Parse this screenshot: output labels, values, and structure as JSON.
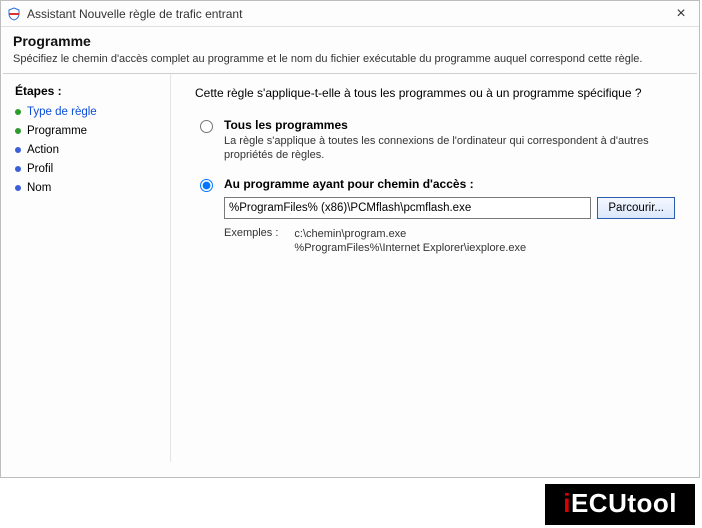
{
  "window": {
    "title": "Assistant Nouvelle règle de trafic entrant",
    "close": "×"
  },
  "header": {
    "title": "Programme",
    "description": "Spécifiez le chemin d'accès complet au programme et le nom du fichier exécutable du programme auquel correspond cette règle."
  },
  "steps": {
    "heading": "Étapes :",
    "items": [
      {
        "label": "Type de règle",
        "bullet": "green",
        "active": true
      },
      {
        "label": "Programme",
        "bullet": "green",
        "active": false
      },
      {
        "label": "Action",
        "bullet": "blue",
        "active": false
      },
      {
        "label": "Profil",
        "bullet": "blue",
        "active": false
      },
      {
        "label": "Nom",
        "bullet": "blue",
        "active": false
      }
    ]
  },
  "content": {
    "question": "Cette règle s'applique-t-elle à tous les programmes ou à un programme spécifique ?",
    "opt_all": {
      "title": "Tous les programmes",
      "desc": "La règle s'applique à toutes les connexions de l'ordinateur qui correspondent à d'autres propriétés de règles."
    },
    "opt_path": {
      "title": "Au programme ayant pour chemin d'accès :",
      "value": "%ProgramFiles% (x86)\\PCMflash\\pcmflash.exe",
      "browse": "Parcourir...",
      "examples_label": "Exemples :",
      "example1": "c:\\chemin\\program.exe",
      "example2": "%ProgramFiles%\\Internet Explorer\\iexplore.exe"
    }
  },
  "watermark": {
    "prefix": "i",
    "rest": "ECUtool"
  }
}
